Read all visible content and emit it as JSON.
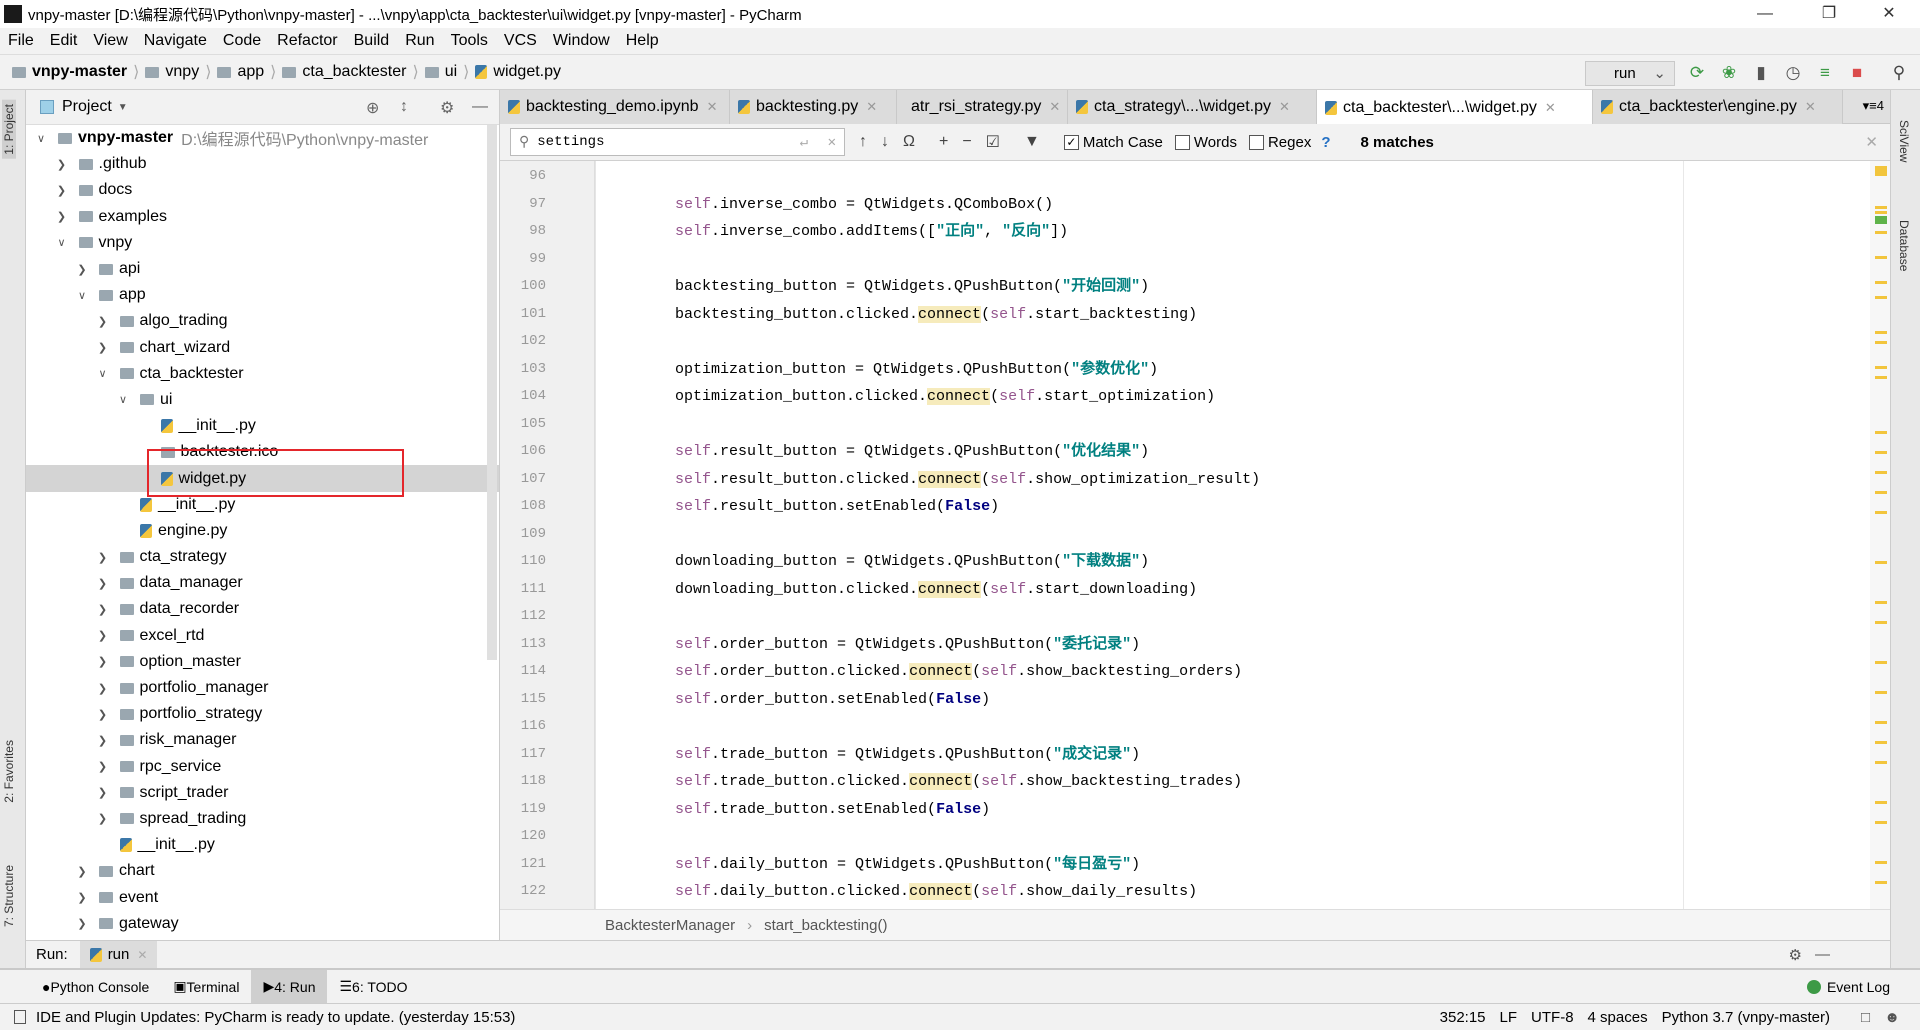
{
  "window": {
    "title": "vnpy-master [D:\\编程源代码\\Python\\vnpy-master] - ...\\vnpy\\app\\cta_backtester\\ui\\widget.py [vnpy-master] - PyCharm",
    "logo": "PC"
  },
  "menu": [
    "File",
    "Edit",
    "View",
    "Navigate",
    "Code",
    "Refactor",
    "Build",
    "Run",
    "Tools",
    "VCS",
    "Window",
    "Help"
  ],
  "breadcrumb": [
    "vnpy-master",
    "vnpy",
    "app",
    "cta_backtester",
    "ui",
    "widget.py"
  ],
  "run_config": "run",
  "left_stripe": {
    "project": "1: Project",
    "favorites": "2: Favorites",
    "structure": "7: Structure"
  },
  "right_stripe": {
    "sciview": "SciView",
    "database": "Database"
  },
  "project": {
    "title": "Project",
    "tree": [
      {
        "label": "vnpy-master",
        "hint": "D:\\编程源代码\\Python\\vnpy-master",
        "depth": 0,
        "type": "folder",
        "open": true,
        "bold": true
      },
      {
        "label": ".github",
        "depth": 1,
        "type": "folder",
        "open": false
      },
      {
        "label": "docs",
        "depth": 1,
        "type": "folder",
        "open": false
      },
      {
        "label": "examples",
        "depth": 1,
        "type": "folder",
        "open": false
      },
      {
        "label": "vnpy",
        "depth": 1,
        "type": "folder",
        "open": true
      },
      {
        "label": "api",
        "depth": 2,
        "type": "folder",
        "open": false
      },
      {
        "label": "app",
        "depth": 2,
        "type": "folder",
        "open": true
      },
      {
        "label": "algo_trading",
        "depth": 3,
        "type": "folder",
        "open": false
      },
      {
        "label": "chart_wizard",
        "depth": 3,
        "type": "folder",
        "open": false
      },
      {
        "label": "cta_backtester",
        "depth": 3,
        "type": "folder",
        "open": true
      },
      {
        "label": "ui",
        "depth": 4,
        "type": "folder",
        "open": true
      },
      {
        "label": "__init__.py",
        "depth": 5,
        "type": "py"
      },
      {
        "label": "backtester.ico",
        "depth": 5,
        "type": "file"
      },
      {
        "label": "widget.py",
        "depth": 5,
        "type": "py",
        "selected": true
      },
      {
        "label": "__init__.py",
        "depth": 4,
        "type": "py"
      },
      {
        "label": "engine.py",
        "depth": 4,
        "type": "py"
      },
      {
        "label": "cta_strategy",
        "depth": 3,
        "type": "folder",
        "open": false
      },
      {
        "label": "data_manager",
        "depth": 3,
        "type": "folder",
        "open": false
      },
      {
        "label": "data_recorder",
        "depth": 3,
        "type": "folder",
        "open": false
      },
      {
        "label": "excel_rtd",
        "depth": 3,
        "type": "folder",
        "open": false
      },
      {
        "label": "option_master",
        "depth": 3,
        "type": "folder",
        "open": false
      },
      {
        "label": "portfolio_manager",
        "depth": 3,
        "type": "folder",
        "open": false
      },
      {
        "label": "portfolio_strategy",
        "depth": 3,
        "type": "folder",
        "open": false
      },
      {
        "label": "risk_manager",
        "depth": 3,
        "type": "folder",
        "open": false
      },
      {
        "label": "rpc_service",
        "depth": 3,
        "type": "folder",
        "open": false
      },
      {
        "label": "script_trader",
        "depth": 3,
        "type": "folder",
        "open": false
      },
      {
        "label": "spread_trading",
        "depth": 3,
        "type": "folder",
        "open": false
      },
      {
        "label": "__init__.py",
        "depth": 3,
        "type": "py"
      },
      {
        "label": "chart",
        "depth": 2,
        "type": "folder",
        "open": false
      },
      {
        "label": "event",
        "depth": 2,
        "type": "folder",
        "open": false
      },
      {
        "label": "gateway",
        "depth": 2,
        "type": "folder",
        "open": false
      }
    ]
  },
  "tabs": [
    {
      "label": "backtesting_demo.ipynb"
    },
    {
      "label": "backtesting.py"
    },
    {
      "label": "atr_rsi_strategy.py"
    },
    {
      "label": "cta_strategy\\...\\widget.py"
    },
    {
      "label": "cta_backtester\\...\\widget.py",
      "active": true
    },
    {
      "label": "cta_backtester\\engine.py"
    }
  ],
  "tabs_overflow": "4",
  "search": {
    "value": "settings",
    "match_case_label": "Match Case",
    "match_case": true,
    "words_label": "Words",
    "words": false,
    "regex_label": "Regex",
    "regex": false,
    "help": "?",
    "matches": "8 matches"
  },
  "code": [
    {
      "n": "96",
      "t": []
    },
    {
      "n": "97",
      "t": [
        [
          "self",
          "self"
        ],
        [
          "",
          ".inverse_combo = QtWidgets.QComboBox()"
        ]
      ]
    },
    {
      "n": "98",
      "t": [
        [
          "self",
          "self"
        ],
        [
          "",
          ".inverse_combo.addItems(["
        ],
        [
          "str",
          "\"正向\""
        ],
        [
          "",
          ", "
        ],
        [
          "str",
          "\"反向\""
        ],
        [
          "",
          "])"
        ]
      ]
    },
    {
      "n": "99",
      "t": []
    },
    {
      "n": "100",
      "t": [
        [
          "",
          "backtesting_button = QtWidgets.QPushButton("
        ],
        [
          "str",
          "\"开始回测\""
        ],
        [
          "",
          ")"
        ]
      ]
    },
    {
      "n": "101",
      "t": [
        [
          "",
          "backtesting_button.clicked."
        ],
        [
          "hl",
          "connect"
        ],
        [
          "",
          "("
        ],
        [
          "self",
          "self"
        ],
        [
          "",
          ".start_backtesting)"
        ]
      ]
    },
    {
      "n": "102",
      "t": []
    },
    {
      "n": "103",
      "t": [
        [
          "",
          "optimization_button = QtWidgets.QPushButton("
        ],
        [
          "str",
          "\"参数优化\""
        ],
        [
          "",
          ")"
        ]
      ]
    },
    {
      "n": "104",
      "t": [
        [
          "",
          "optimization_button.clicked."
        ],
        [
          "hl",
          "connect"
        ],
        [
          "",
          "("
        ],
        [
          "self",
          "self"
        ],
        [
          "",
          ".start_optimization)"
        ]
      ]
    },
    {
      "n": "105",
      "t": []
    },
    {
      "n": "106",
      "t": [
        [
          "self",
          "self"
        ],
        [
          "",
          ".result_button = QtWidgets.QPushButton("
        ],
        [
          "str",
          "\"优化结果\""
        ],
        [
          "",
          ")"
        ]
      ]
    },
    {
      "n": "107",
      "t": [
        [
          "self",
          "self"
        ],
        [
          "",
          ".result_button.clicked."
        ],
        [
          "hl",
          "connect"
        ],
        [
          "",
          "("
        ],
        [
          "self",
          "self"
        ],
        [
          "",
          ".show_optimization_result)"
        ]
      ]
    },
    {
      "n": "108",
      "t": [
        [
          "self",
          "self"
        ],
        [
          "",
          ".result_button.setEnabled("
        ],
        [
          "kw",
          "False"
        ],
        [
          "",
          ")"
        ]
      ]
    },
    {
      "n": "109",
      "t": []
    },
    {
      "n": "110",
      "t": [
        [
          "",
          "downloading_button = QtWidgets.QPushButton("
        ],
        [
          "str",
          "\"下载数据\""
        ],
        [
          "",
          ")"
        ]
      ]
    },
    {
      "n": "111",
      "t": [
        [
          "",
          "downloading_button.clicked."
        ],
        [
          "hl",
          "connect"
        ],
        [
          "",
          "("
        ],
        [
          "self",
          "self"
        ],
        [
          "",
          ".start_downloading)"
        ]
      ]
    },
    {
      "n": "112",
      "t": []
    },
    {
      "n": "113",
      "t": [
        [
          "self",
          "self"
        ],
        [
          "",
          ".order_button = QtWidgets.QPushButton("
        ],
        [
          "str",
          "\"委托记录\""
        ],
        [
          "",
          ")"
        ]
      ]
    },
    {
      "n": "114",
      "t": [
        [
          "self",
          "self"
        ],
        [
          "",
          ".order_button.clicked."
        ],
        [
          "hl",
          "connect"
        ],
        [
          "",
          "("
        ],
        [
          "self",
          "self"
        ],
        [
          "",
          ".show_backtesting_orders)"
        ]
      ]
    },
    {
      "n": "115",
      "t": [
        [
          "self",
          "self"
        ],
        [
          "",
          ".order_button.setEnabled("
        ],
        [
          "kw",
          "False"
        ],
        [
          "",
          ")"
        ]
      ]
    },
    {
      "n": "116",
      "t": []
    },
    {
      "n": "117",
      "t": [
        [
          "self",
          "self"
        ],
        [
          "",
          ".trade_button = QtWidgets.QPushButton("
        ],
        [
          "str",
          "\"成交记录\""
        ],
        [
          "",
          ")"
        ]
      ]
    },
    {
      "n": "118",
      "t": [
        [
          "self",
          "self"
        ],
        [
          "",
          ".trade_button.clicked."
        ],
        [
          "hl",
          "connect"
        ],
        [
          "",
          "("
        ],
        [
          "self",
          "self"
        ],
        [
          "",
          ".show_backtesting_trades)"
        ]
      ]
    },
    {
      "n": "119",
      "t": [
        [
          "self",
          "self"
        ],
        [
          "",
          ".trade_button.setEnabled("
        ],
        [
          "kw",
          "False"
        ],
        [
          "",
          ")"
        ]
      ]
    },
    {
      "n": "120",
      "t": []
    },
    {
      "n": "121",
      "t": [
        [
          "self",
          "self"
        ],
        [
          "",
          ".daily_button = QtWidgets.QPushButton("
        ],
        [
          "str",
          "\"每日盈亏\""
        ],
        [
          "",
          ")"
        ]
      ]
    },
    {
      "n": "122",
      "t": [
        [
          "self",
          "self"
        ],
        [
          "",
          ".daily_button.clicked."
        ],
        [
          "hl",
          "connect"
        ],
        [
          "",
          "("
        ],
        [
          "self",
          "self"
        ],
        [
          "",
          ".show_daily_results)"
        ]
      ]
    }
  ],
  "editor_breadcrumb": [
    "BacktesterManager",
    "start_backtesting()"
  ],
  "run_panel": {
    "label": "Run:",
    "tab": "run"
  },
  "tool_windows": [
    {
      "label": "Python Console"
    },
    {
      "label": "Terminal"
    },
    {
      "label": "4: Run",
      "active": true
    },
    {
      "label": "6: TODO"
    }
  ],
  "event_log": "Event Log",
  "status": {
    "message": "IDE and Plugin Updates: PyCharm is ready to update. (yesterday 15:53)",
    "position": "352:15",
    "line_sep": "LF",
    "encoding": "UTF-8",
    "indent": "4 spaces",
    "interpreter": "Python 3.7 (vnpy-master)"
  },
  "colors": {
    "accent_selection": "#d4d4d4",
    "highlight": "#f6ebbc",
    "string": "#008080",
    "self": "#94558d",
    "keyword": "#000080",
    "red_box": "#e4262b"
  }
}
